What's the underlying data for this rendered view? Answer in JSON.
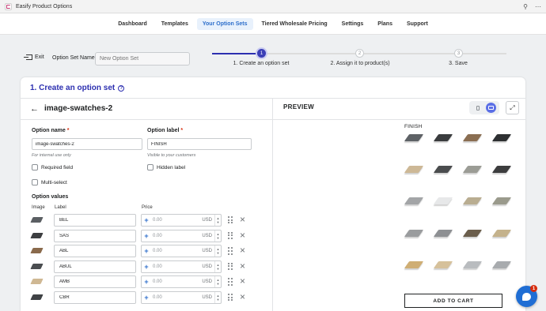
{
  "app": {
    "title": "Easify Product Options",
    "pin_icon": "pin-icon",
    "more_icon": "more-icon"
  },
  "nav": {
    "tabs": [
      {
        "label": "Dashboard",
        "active": false
      },
      {
        "label": "Templates",
        "active": false
      },
      {
        "label": "Your Option Sets",
        "active": true
      },
      {
        "label": "Tiered Wholesale Pricing",
        "active": false
      },
      {
        "label": "Settings",
        "active": false
      },
      {
        "label": "Plans",
        "active": false
      },
      {
        "label": "Support",
        "active": false
      }
    ]
  },
  "header": {
    "exit_label": "Exit",
    "set_name_label": "Option Set Name",
    "set_name_placeholder": "New Option Set",
    "steps": [
      {
        "number": "1",
        "label": "1. Create an option set",
        "state": "active"
      },
      {
        "number": "2",
        "label": "2. Assign it to product(s)",
        "state": "inactive"
      },
      {
        "number": "3",
        "label": "3. Save",
        "state": "inactive"
      }
    ]
  },
  "card": {
    "title": "1. Create an option set",
    "help_glyph": "?"
  },
  "editor": {
    "back_glyph": "←",
    "heading": "image-swatches-2",
    "option_name_label": "Option name",
    "option_name_value": "image-swatches-2",
    "option_name_hint": "For internal use only",
    "option_label_label": "Option label",
    "option_label_value": "FINISH",
    "option_label_hint": "Visible to your customers",
    "required_mark": "*",
    "required_field_label": "Required field",
    "hidden_label_label": "Hidden label",
    "multi_select_label": "Multi-select",
    "values_title": "Option values",
    "columns": {
      "image": "Image",
      "label": "Label",
      "price": "Price"
    },
    "values": [
      {
        "label": "BEL",
        "price_placeholder": "0.00",
        "currency": "USD",
        "color": "#5b5f63"
      },
      {
        "label": "SAS",
        "price_placeholder": "0.00",
        "currency": "USD",
        "color": "#3d3f41"
      },
      {
        "label": "ABL",
        "price_placeholder": "0.00",
        "currency": "USD",
        "color": "#8a6a4c"
      },
      {
        "label": "ABUL",
        "price_placeholder": "0.00",
        "currency": "USD",
        "color": "#4a4d50"
      },
      {
        "label": "AMB",
        "price_placeholder": "0.00",
        "currency": "USD",
        "color": "#cfb893"
      },
      {
        "label": "CBR",
        "price_placeholder": "0.00",
        "currency": "USD",
        "color": "#3f4245"
      }
    ]
  },
  "preview": {
    "title": "PREVIEW",
    "option_label": "FINISH",
    "add_to_cart": "ADD TO CART",
    "swatches": [
      "#5e6266",
      "#3a3c3e",
      "#8a6e52",
      "#2e3032",
      "#cdb896",
      "#4a4c4e",
      "#9b9c95",
      "#3c3d3e",
      "#a3a5a7",
      "#e7e8e9",
      "#b9ad91",
      "#9a9a8c",
      "#9a9c9e",
      "#8e9093",
      "#6b5e4c",
      "#c4b28c",
      "#cfae74",
      "#d6c19b",
      "#b9bcbf",
      "#a8abae"
    ]
  },
  "chat": {
    "badge": "1"
  }
}
